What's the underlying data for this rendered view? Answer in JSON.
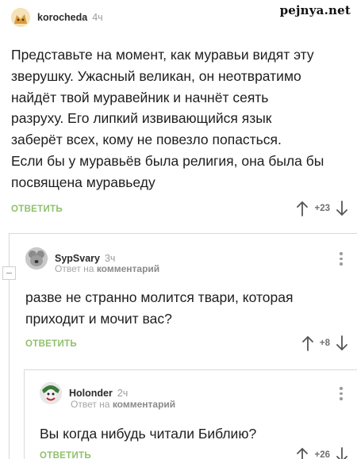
{
  "watermark": "pejnya.net",
  "comments": [
    {
      "author": "korocheda",
      "time": "4ч",
      "lines": [
        "Представьте на момент, как муравьи видят эту",
        "зверушку. Ужасный великан, он неотвратимо",
        "найдёт твой муравейник и начнёт сеять",
        "разруху. Его липкий извивающийся язык",
        "заберёт всех, кому не повезло попасться.",
        "Если бы у муравьёв была религия, она была бы",
        "посвящена муравьеду"
      ],
      "reply_label": "ОТВЕТИТЬ",
      "rating": "+23"
    },
    {
      "author": "SypSvary",
      "time": "3ч",
      "reply_to_prefix": "Ответ на",
      "reply_to_target": "комментарий",
      "lines": [
        "разве не странно молится твари, которая",
        "приходит и мочит вас?"
      ],
      "reply_label": "ОТВЕТИТЬ",
      "rating": "+8"
    },
    {
      "author": "Holonder",
      "time": "2ч",
      "reply_to_prefix": "Ответ на",
      "reply_to_target": "комментарий",
      "lines": [
        "Вы когда нибудь читали Библию?"
      ],
      "reply_label": "ОТВЕТИТЬ",
      "rating": "+26"
    }
  ],
  "colors": {
    "reply_button": "#8fc06b",
    "thread_line": "#d9d9d9",
    "muted_text": "#9b9b9b"
  },
  "icons": {
    "upvote": "arrow-up-icon",
    "downvote": "arrow-down-icon",
    "menu": "more-vertical-icon"
  }
}
